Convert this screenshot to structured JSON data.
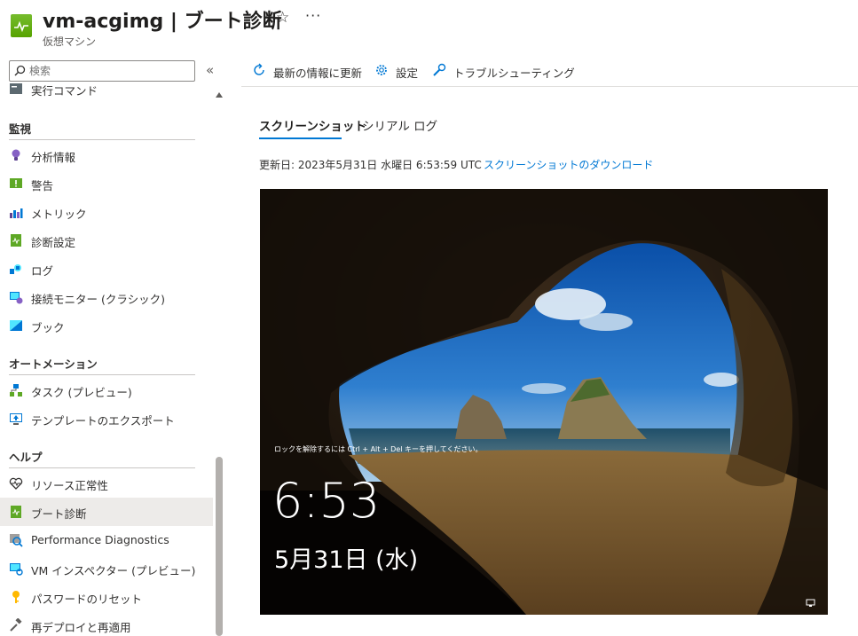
{
  "header": {
    "title": "vm-acgimg | ブート診断",
    "subtitle": "仮想マシン",
    "favorite_icon": "star-icon",
    "more_icon": "more-icon"
  },
  "sidebar": {
    "search_placeholder": "検索",
    "partial_item": "実行コマンド",
    "sections": {
      "monitoring": "監視",
      "automation": "オートメーション",
      "help": "ヘルプ"
    },
    "items": {
      "insights": "分析情報",
      "alerts": "警告",
      "metrics": "メトリック",
      "diag_settings": "診断設定",
      "logs": "ログ",
      "conn_monitor": "接続モニター (クラシック)",
      "workbooks": "ブック",
      "tasks": "タスク (プレビュー)",
      "export_template": "テンプレートのエクスポート",
      "resource_health": "リソース正常性",
      "boot_diag": "ブート診断",
      "perf_diag": "Performance Diagnostics",
      "vm_inspector": "VM インスペクター (プレビュー)",
      "reset_password": "パスワードのリセット",
      "redeploy": "再デプロイと再適用"
    },
    "selected": "boot_diag"
  },
  "toolbar": {
    "refresh": "最新の情報に更新",
    "settings": "設定",
    "troubleshoot": "トラブルシューティング"
  },
  "tabs": {
    "screenshot": "スクリーンショット",
    "serial_log": "シリアル ログ",
    "active": "screenshot"
  },
  "content": {
    "updated": "更新日: 2023年5月31日 水曜日 6:53:59 UTC",
    "download_link": "スクリーンショットのダウンロード"
  },
  "lockscreen": {
    "hint": "ロックを解除するには Ctrl + Alt + Del キーを押してください。",
    "time": "6:53",
    "date": "5月31日 (水)"
  },
  "colors": {
    "accent": "#0078d4",
    "selected_bg": "#edebe9"
  }
}
